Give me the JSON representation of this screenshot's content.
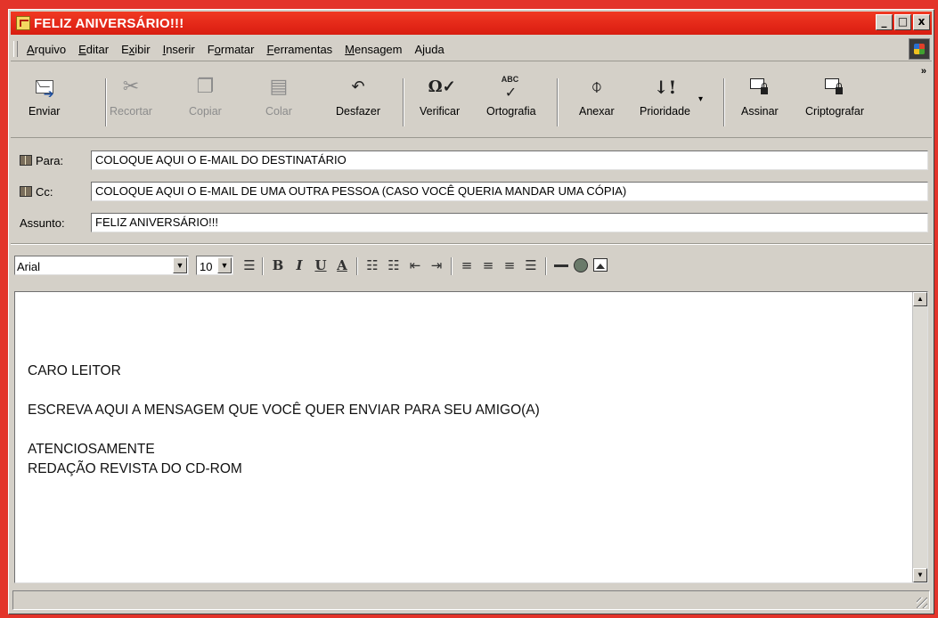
{
  "window": {
    "title": "FELIZ ANIVERSÁRIO!!!",
    "controls": {
      "minimize": "_",
      "maximize": "□",
      "close": "x"
    }
  },
  "menu": [
    {
      "label": "Arquivo",
      "mnemonic": "A",
      "rest": "rquivo"
    },
    {
      "label": "Editar",
      "mnemonic": "E",
      "rest": "ditar"
    },
    {
      "label": "Exibir",
      "mnemonic": "x",
      "pre": "E",
      "rest": "ibir"
    },
    {
      "label": "Inserir",
      "mnemonic": "I",
      "rest": "nserir"
    },
    {
      "label": "Formatar",
      "mnemonic": "o",
      "pre": "F",
      "rest": "rmatar"
    },
    {
      "label": "Ferramentas",
      "mnemonic": "F",
      "rest": "erramentas"
    },
    {
      "label": "Mensagem",
      "mnemonic": "M",
      "rest": "ensagem"
    },
    {
      "label": "Ajuda",
      "mnemonic": "",
      "rest": "Ajuda"
    }
  ],
  "toolbar": {
    "send": "Enviar",
    "cut": "Recortar",
    "copy": "Copiar",
    "paste": "Colar",
    "undo": "Desfazer",
    "check": "Verificar",
    "spelling": "Ortografia",
    "attach": "Anexar",
    "priority": "Prioridade",
    "sign": "Assinar",
    "encrypt": "Criptografar",
    "more": "»"
  },
  "header": {
    "to_label": "Para:",
    "to_value": "COLOQUE AQUI O E-MAIL DO DESTINATÁRIO",
    "cc_label": "Cc:",
    "cc_value": "COLOQUE AQUI O E-MAIL DE UMA OUTRA PESSOA (CASO VOCÊ QUERIA MANDAR UMA CÓPIA)",
    "subject_label": "Assunto:",
    "subject_value": "FELIZ ANIVERSÁRIO!!!"
  },
  "format": {
    "font": "Arial",
    "size": "10",
    "bold": "B",
    "italic": "I",
    "underline": "U",
    "color": "A"
  },
  "body": {
    "greeting": "CARO LEITOR",
    "message": "ESCREVA AQUI A MENSAGEM QUE VOCÊ QUER ENVIAR PARA SEU AMIGO(A)",
    "closing": "ATENCIOSAMENTE",
    "signature": "REDAÇÃO REVISTA DO CD-ROM"
  },
  "colors": {
    "desktop": "#e3342a",
    "titlebar": "#e32718",
    "chrome": "#d4d0c8"
  }
}
